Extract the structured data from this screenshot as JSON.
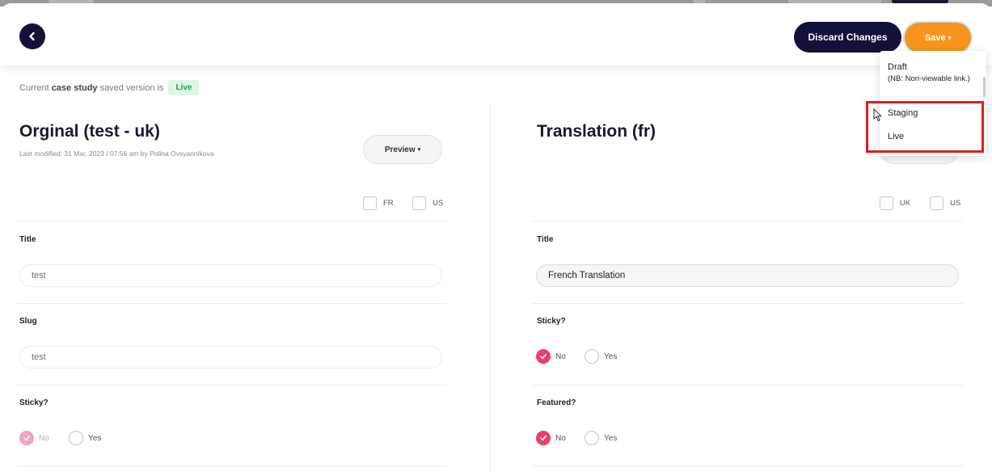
{
  "header": {
    "discard_label": "Discard Changes",
    "save_label": "Save",
    "save_caret": "▾"
  },
  "save_menu": {
    "draft_label": "Draft",
    "draft_note": "(NB: Non-viewable link.)",
    "staging_label": "Staging",
    "live_label": "Live"
  },
  "status": {
    "prefix": "Current",
    "entity": "case study",
    "suffix": "saved version is",
    "badge": "Live"
  },
  "original": {
    "title": "Orginal (test - uk)",
    "modified": "Last modified: 31 Mar, 2023 / 07:56 am by Polina Ovsyannikova",
    "preview_label": "Preview",
    "preview_caret": "▾",
    "checkboxes": [
      "FR",
      "US"
    ],
    "title_label": "Title",
    "title_value": "test",
    "slug_label": "Slug",
    "slug_value": "test",
    "sticky_label": "Sticky?",
    "sticky_options": [
      "No",
      "Yes"
    ]
  },
  "translation": {
    "title": "Translation (fr)",
    "checkboxes": [
      "UK",
      "US"
    ],
    "title_label": "Title",
    "title_value": "French Translation",
    "sticky_label": "Sticky?",
    "sticky_options": [
      "No",
      "Yes"
    ],
    "featured_label": "Featured?",
    "featured_options": [
      "No",
      "Yes"
    ]
  },
  "colors": {
    "navy": "#12113a",
    "orange": "#f7941d",
    "pink": "#ec3d6c",
    "live_green": "#1aa84a",
    "highlight_red": "#e11d1d"
  }
}
